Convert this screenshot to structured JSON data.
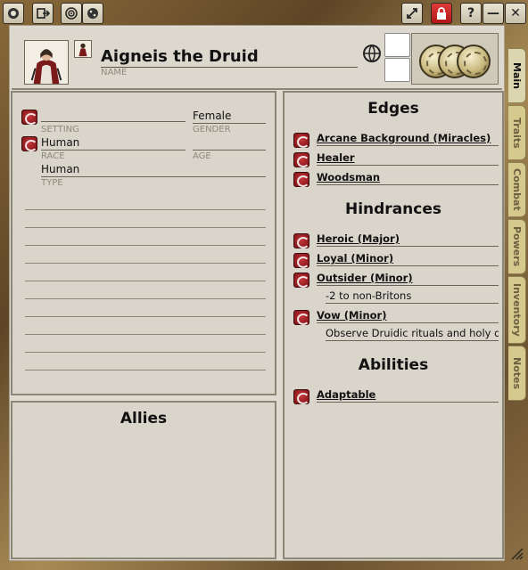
{
  "toolbar": {
    "buttons": [
      "app-icon",
      "share-icon",
      "target-icon",
      "dice-icon"
    ],
    "right_buttons": [
      "minimize-arrows-icon",
      "lock-icon",
      "help",
      "minimize",
      "close"
    ],
    "help_label": "?",
    "minimize_label": "—",
    "close_label": "✕"
  },
  "header": {
    "name": "Aigneis the Druid",
    "name_label": "NAME"
  },
  "details": {
    "setting_value": "",
    "setting_label": "SETTING",
    "gender_value": "Female",
    "gender_label": "GENDER",
    "race_value": "Human",
    "race_label": "RACE",
    "age_value": "",
    "age_label": "AGE",
    "type_value": "Human",
    "type_label": "TYPE"
  },
  "allies": {
    "title": "Allies"
  },
  "edges": {
    "title": "Edges",
    "items": [
      "Arcane Background (Miracles)",
      "Healer",
      "Woodsman"
    ]
  },
  "hindrances": {
    "title": "Hindrances",
    "items": [
      {
        "label": "Heroic (Major)",
        "note": ""
      },
      {
        "label": "Loyal (Minor)",
        "note": ""
      },
      {
        "label": "Outsider (Minor)",
        "note": "-2 to non-Britons"
      },
      {
        "label": "Vow (Minor)",
        "note": "Observe Druidic rituals and holy da"
      }
    ]
  },
  "abilities": {
    "title": "Abilities",
    "items": [
      "Adaptable"
    ]
  },
  "tabs": [
    "Main",
    "Traits",
    "Combat",
    "Powers",
    "Inventory",
    "Notes"
  ],
  "colors": {
    "accent_red": "#b01515",
    "tab_gold": "#d6c98e",
    "paper": "#d9d5cb"
  }
}
